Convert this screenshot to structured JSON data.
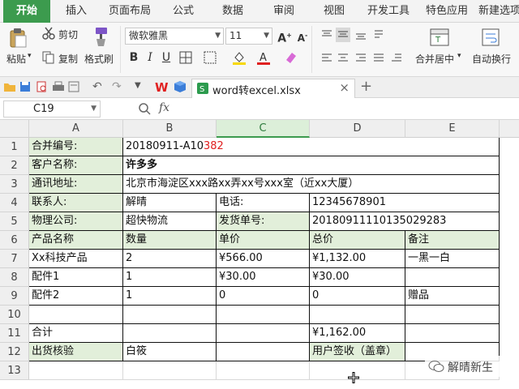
{
  "ribbon": {
    "tabs": [
      "开始",
      "插入",
      "页面布局",
      "公式",
      "数据",
      "审阅",
      "视图",
      "开发工具",
      "特色应用",
      "新建选项"
    ],
    "active_tab": "开始"
  },
  "toolbar": {
    "cut": "剪切",
    "paste": "粘贴",
    "copy": "复制",
    "format_painter": "格式刷",
    "font_name": "微软雅黑",
    "font_size": "11",
    "merge_center": "合并居中",
    "wrap_text": "自动换行"
  },
  "file_tab": {
    "name": "word转excel.xlsx",
    "close": "×",
    "add": "+"
  },
  "formula_bar": {
    "name_box": "C19",
    "fx": "fx"
  },
  "columns": [
    "A",
    "B",
    "C",
    "D",
    "E"
  ],
  "rows": [
    "1",
    "2",
    "3",
    "4",
    "5",
    "6",
    "7",
    "8",
    "9",
    "10",
    "11",
    "12",
    "13"
  ],
  "sheet": {
    "r1": {
      "A": "合并编号:",
      "B_prefix": "20180911-A10",
      "B_red": "382"
    },
    "r2": {
      "A": "客户名称:",
      "B": "许多多"
    },
    "r3": {
      "A": "通讯地址:",
      "B": "北京市海淀区xxx路xx弄xx号xxx室（近xx大厦）"
    },
    "r4": {
      "A": "联系人:",
      "B": "解晴",
      "C": "电话:",
      "D": "12345678901"
    },
    "r5": {
      "A": "物理公司:",
      "B": "超快物流",
      "C": "发货单号:",
      "D": "20180911110135029283"
    },
    "r6": {
      "A": "产品名称",
      "B": "数量",
      "C": "单价",
      "D": "总价",
      "E": "备注"
    },
    "r7": {
      "A": "Xx科技产品",
      "B": "2",
      "C": "¥566.00",
      "D": "¥1,132.00",
      "E": "一黑一白"
    },
    "r8": {
      "A": "配件1",
      "B": "1",
      "C": "¥30.00",
      "D": "¥30.00",
      "E": ""
    },
    "r9": {
      "A": "配件2",
      "B": "1",
      "C": "0",
      "D": "0",
      "E": "赠品"
    },
    "r11": {
      "A": "合计",
      "D": "¥1,162.00"
    },
    "r12": {
      "A": "出货核验",
      "B": "白筱",
      "D": "用户签收（盖章）"
    }
  },
  "watermark": "解晴新生"
}
